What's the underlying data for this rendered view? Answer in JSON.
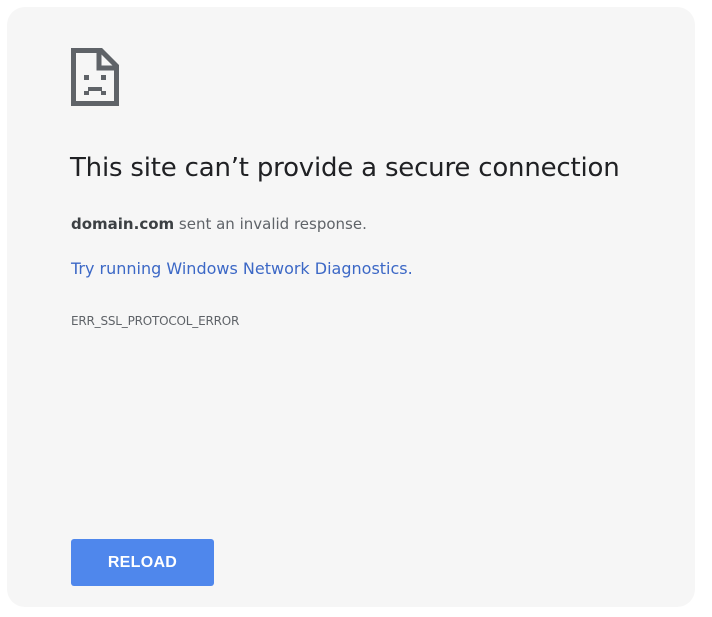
{
  "error_page": {
    "icon": "sad-document-icon",
    "title": "This site can’t provide a secure connection",
    "detail_domain": "domain.com",
    "detail_message": " sent an invalid response.",
    "diagnostics_link": "Try running Windows Network Diagnostics.",
    "error_code": "ERR_SSL_PROTOCOL_ERROR",
    "reload_label": "RELOAD"
  },
  "colors": {
    "background": "#f6f6f6",
    "title": "#202124",
    "link": "#3c68c6",
    "button": "#4f87ec",
    "button_text": "#ffffff"
  }
}
